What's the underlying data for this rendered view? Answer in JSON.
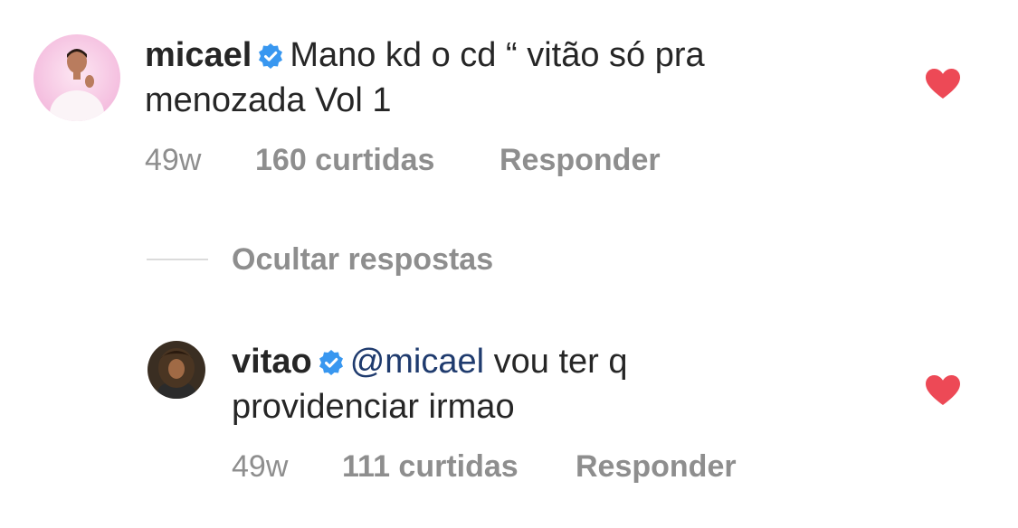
{
  "comment": {
    "username": "micael",
    "verified": true,
    "text_line1": "Mano kd o cd “ vitão só pra",
    "text_line2": "menozada Vol 1",
    "time": "49w",
    "likes": "160 curtidas",
    "reply_label": "Responder",
    "liked": true,
    "avatar_icon": "avatar-photo"
  },
  "hide_replies_label": "Ocultar respostas",
  "reply": {
    "username": "vitao",
    "verified": true,
    "mention": "@micael",
    "text_after_mention": " vou ter q",
    "text_line2": "providenciar irmao",
    "time": "49w",
    "likes": "111 curtidas",
    "reply_label": "Responder",
    "liked": true,
    "avatar_icon": "avatar-photo"
  },
  "colors": {
    "heart": "#ed4956",
    "verified_badge": "#3897f0",
    "mention": "#1f3b6e",
    "secondary_text": "#8e8e8e"
  }
}
